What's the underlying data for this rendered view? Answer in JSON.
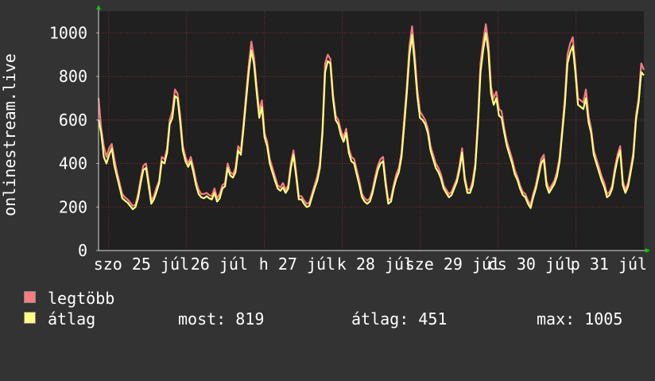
{
  "chart_data": {
    "type": "line",
    "ylabel": "onlinestream.live",
    "ylim": [
      0,
      1100
    ],
    "yticks": [
      0,
      200,
      400,
      600,
      800,
      1000
    ],
    "grid": true,
    "xtick_labels": [
      "szo 25 júl",
      "26 júl",
      "h 27 júl",
      "k 28 júl",
      "sze 29 júl",
      "cs 30 júl",
      "p 31 júl"
    ],
    "day_tick_count": 7,
    "series": [
      {
        "name": "legtöbb",
        "color": "#f77b7f",
        "values": [
          700,
          560,
          480,
          430,
          470,
          490,
          420,
          360,
          310,
          260,
          245,
          235,
          220,
          205,
          210,
          260,
          330,
          390,
          400,
          320,
          230,
          250,
          290,
          320,
          430,
          420,
          470,
          600,
          640,
          740,
          720,
          620,
          480,
          430,
          400,
          430,
          380,
          320,
          280,
          260,
          260,
          265,
          255,
          250,
          285,
          240,
          260,
          300,
          310,
          400,
          360,
          350,
          380,
          480,
          460,
          580,
          720,
          850,
          960,
          890,
          760,
          640,
          690,
          540,
          500,
          420,
          380,
          340,
          300,
          290,
          310,
          280,
          300,
          400,
          460,
          360,
          250,
          250,
          230,
          215,
          220,
          260,
          300,
          340,
          400,
          560,
          860,
          900,
          880,
          720,
          620,
          600,
          550,
          520,
          560,
          470,
          430,
          420,
          370,
          320,
          260,
          240,
          230,
          240,
          280,
          340,
          390,
          420,
          430,
          320,
          230,
          240,
          300,
          350,
          380,
          450,
          600,
          750,
          940,
          1030,
          900,
          740,
          640,
          620,
          600,
          560,
          480,
          440,
          400,
          380,
          350,
          300,
          280,
          260,
          270,
          300,
          330,
          390,
          470,
          340,
          280,
          280,
          320,
          400,
          600,
          860,
          960,
          1040,
          950,
          750,
          700,
          730,
          650,
          640,
          560,
          500,
          460,
          420,
          370,
          340,
          300,
          270,
          260,
          230,
          210,
          260,
          300,
          360,
          420,
          440,
          320,
          280,
          300,
          320,
          360,
          430,
          560,
          700,
          900,
          950,
          980,
          850,
          700,
          690,
          680,
          740,
          620,
          560,
          460,
          420,
          380,
          340,
          310,
          260,
          270,
          300,
          380,
          440,
          480,
          320,
          280,
          310,
          380,
          450,
          620,
          700,
          860,
          830
        ]
      },
      {
        "name": "átlag",
        "color": "#ffff80",
        "values": [
          600,
          540,
          430,
          400,
          440,
          470,
          390,
          340,
          290,
          240,
          230,
          220,
          205,
          190,
          200,
          240,
          310,
          370,
          380,
          300,
          215,
          235,
          270,
          310,
          410,
          400,
          450,
          580,
          610,
          710,
          700,
          590,
          460,
          410,
          385,
          410,
          360,
          300,
          260,
          245,
          240,
          250,
          240,
          235,
          265,
          225,
          240,
          285,
          295,
          380,
          345,
          335,
          360,
          460,
          440,
          560,
          690,
          820,
          920,
          860,
          730,
          610,
          660,
          520,
          480,
          400,
          360,
          320,
          285,
          275,
          290,
          265,
          285,
          380,
          440,
          340,
          235,
          235,
          215,
          200,
          205,
          245,
          285,
          320,
          380,
          540,
          820,
          870,
          860,
          700,
          600,
          580,
          530,
          500,
          540,
          450,
          410,
          400,
          350,
          300,
          245,
          225,
          215,
          225,
          265,
          320,
          370,
          400,
          410,
          300,
          215,
          225,
          285,
          330,
          360,
          430,
          570,
          720,
          900,
          990,
          860,
          710,
          610,
          600,
          580,
          540,
          460,
          420,
          380,
          360,
          330,
          285,
          265,
          245,
          255,
          285,
          315,
          370,
          450,
          325,
          265,
          265,
          300,
          380,
          570,
          820,
          920,
          1000,
          910,
          720,
          670,
          700,
          620,
          610,
          540,
          480,
          440,
          400,
          350,
          325,
          285,
          255,
          245,
          215,
          195,
          245,
          285,
          340,
          400,
          420,
          300,
          265,
          285,
          305,
          340,
          410,
          540,
          670,
          860,
          910,
          940,
          820,
          670,
          660,
          650,
          700,
          590,
          540,
          440,
          400,
          360,
          320,
          290,
          245,
          255,
          285,
          360,
          420,
          460,
          300,
          265,
          295,
          360,
          430,
          600,
          680,
          820,
          805
        ]
      }
    ]
  },
  "legend": [
    {
      "label": "legtöbb",
      "color": "#f77b7f"
    },
    {
      "label": "átlag",
      "color": "#ffff80"
    }
  ],
  "stats": {
    "most": "most: 819",
    "atlag": "átlag: 451",
    "max": "max: 1005"
  }
}
